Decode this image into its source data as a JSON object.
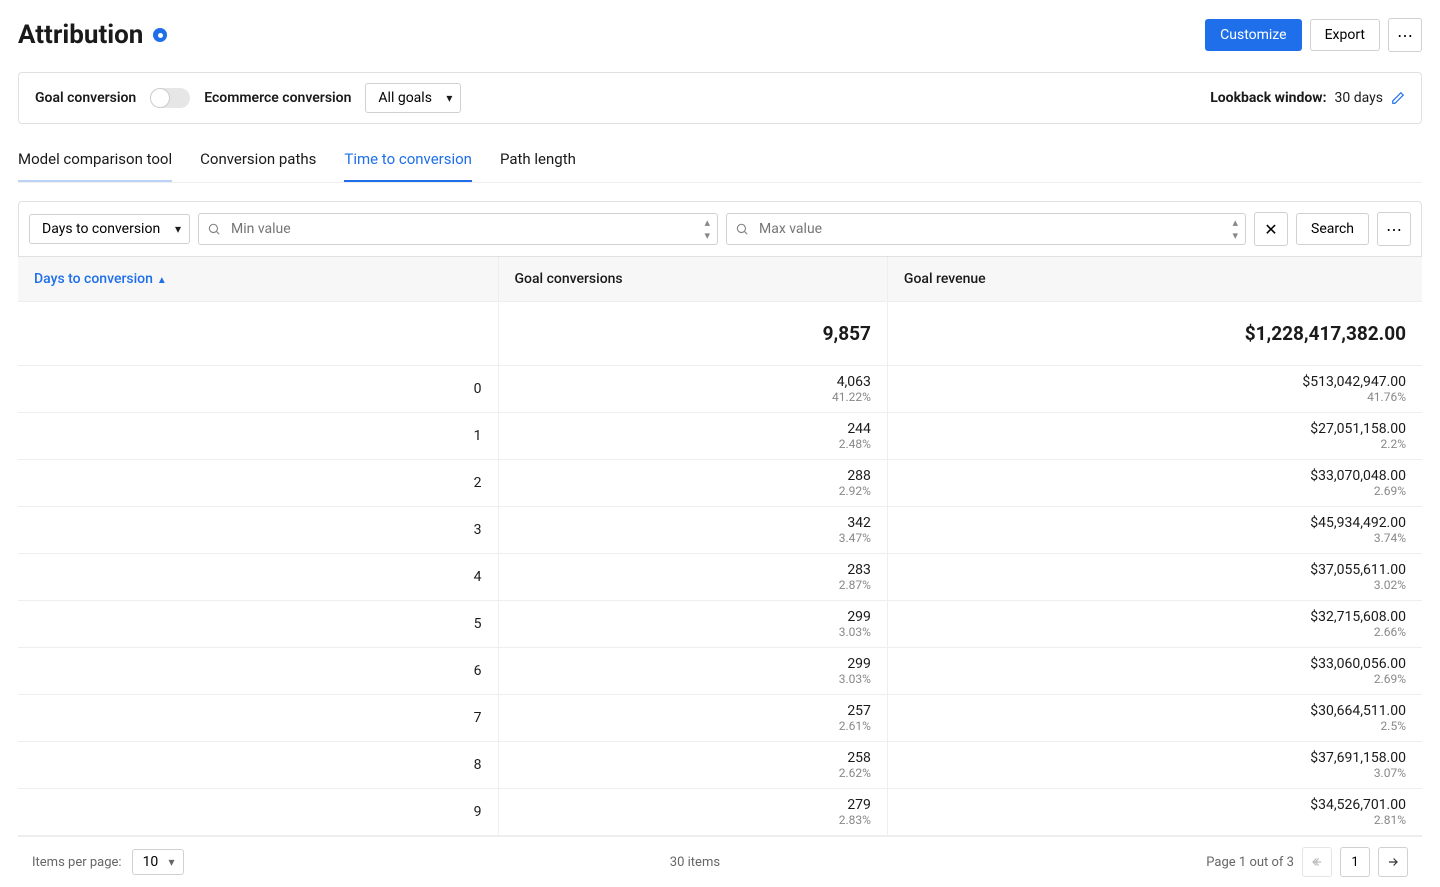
{
  "header": {
    "title": "Attribution",
    "customize": "Customize",
    "export": "Export"
  },
  "filters": {
    "goal_conversion_label": "Goal conversion",
    "ecommerce_conversion_label": "Ecommerce conversion",
    "goals_select": "All goals",
    "lookback_label": "Lookback window:",
    "lookback_value": "30 days"
  },
  "tabs": [
    {
      "label": "Model comparison tool",
      "active": false,
      "underline": true
    },
    {
      "label": "Conversion paths",
      "active": false
    },
    {
      "label": "Time to conversion",
      "active": true
    },
    {
      "label": "Path length",
      "active": false
    }
  ],
  "filter_row": {
    "dimension_select": "Days to conversion",
    "min_placeholder": "Min value",
    "max_placeholder": "Max value",
    "search_button": "Search"
  },
  "table": {
    "columns": [
      "Days to conversion",
      "Goal conversions",
      "Goal revenue"
    ],
    "totals": {
      "conversions": "9,857",
      "revenue": "$1,228,417,382.00"
    },
    "rows": [
      {
        "days": "0",
        "conv": "4,063",
        "conv_pct": "41.22%",
        "rev": "$513,042,947.00",
        "rev_pct": "41.76%"
      },
      {
        "days": "1",
        "conv": "244",
        "conv_pct": "2.48%",
        "rev": "$27,051,158.00",
        "rev_pct": "2.2%"
      },
      {
        "days": "2",
        "conv": "288",
        "conv_pct": "2.92%",
        "rev": "$33,070,048.00",
        "rev_pct": "2.69%"
      },
      {
        "days": "3",
        "conv": "342",
        "conv_pct": "3.47%",
        "rev": "$45,934,492.00",
        "rev_pct": "3.74%"
      },
      {
        "days": "4",
        "conv": "283",
        "conv_pct": "2.87%",
        "rev": "$37,055,611.00",
        "rev_pct": "3.02%"
      },
      {
        "days": "5",
        "conv": "299",
        "conv_pct": "3.03%",
        "rev": "$32,715,608.00",
        "rev_pct": "2.66%"
      },
      {
        "days": "6",
        "conv": "299",
        "conv_pct": "3.03%",
        "rev": "$33,060,056.00",
        "rev_pct": "2.69%"
      },
      {
        "days": "7",
        "conv": "257",
        "conv_pct": "2.61%",
        "rev": "$30,664,511.00",
        "rev_pct": "2.5%"
      },
      {
        "days": "8",
        "conv": "258",
        "conv_pct": "2.62%",
        "rev": "$37,691,158.00",
        "rev_pct": "3.07%"
      },
      {
        "days": "9",
        "conv": "279",
        "conv_pct": "2.83%",
        "rev": "$34,526,701.00",
        "rev_pct": "2.81%"
      }
    ]
  },
  "pager": {
    "items_per_page_label": "Items per page:",
    "items_per_page_value": "10",
    "total_items": "30 items",
    "page_info": "Page 1 out of 3",
    "current_page": "1"
  }
}
